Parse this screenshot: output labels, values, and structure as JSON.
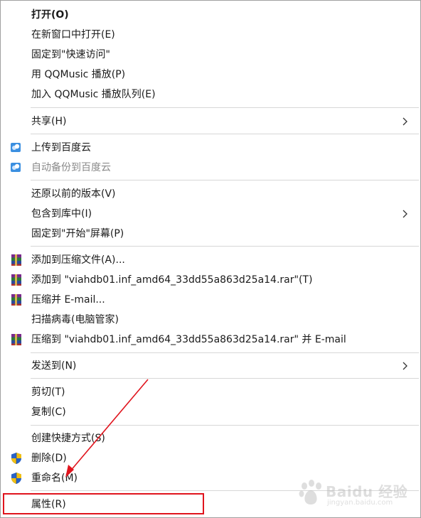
{
  "menu": {
    "groups": [
      {
        "items": [
          {
            "label": "打开(O)",
            "icon": null
          },
          {
            "label": "在新窗口中打开(E)",
            "icon": null
          },
          {
            "label": "固定到\"快速访问\"",
            "icon": null
          },
          {
            "label": "用 QQMusic 播放(P)",
            "icon": null
          },
          {
            "label": "加入 QQMusic 播放队列(E)",
            "icon": null
          }
        ]
      },
      {
        "items": [
          {
            "label": "共享(H)",
            "icon": null,
            "submenu": true
          }
        ]
      },
      {
        "items": [
          {
            "label": "上传到百度云",
            "icon": "baidu-cloud-icon"
          },
          {
            "label": "自动备份到百度云",
            "icon": "baidu-cloud-icon",
            "disabled": true
          }
        ]
      },
      {
        "items": [
          {
            "label": "还原以前的版本(V)",
            "icon": null
          },
          {
            "label": "包含到库中(I)",
            "icon": null,
            "submenu": true
          },
          {
            "label": "固定到\"开始\"屏幕(P)",
            "icon": null
          }
        ]
      },
      {
        "items": [
          {
            "label": "添加到压缩文件(A)...",
            "icon": "winrar-icon"
          },
          {
            "label": "添加到 \"viahdb01.inf_amd64_33dd55a863d25a14.rar\"(T)",
            "icon": "winrar-icon"
          },
          {
            "label": "压缩并 E-mail...",
            "icon": "winrar-icon"
          },
          {
            "label": "扫描病毒(电脑管家)",
            "icon": null
          },
          {
            "label": "压缩到 \"viahdb01.inf_amd64_33dd55a863d25a14.rar\" 并 E-mail",
            "icon": "winrar-icon"
          }
        ]
      },
      {
        "items": [
          {
            "label": "发送到(N)",
            "icon": null,
            "submenu": true
          }
        ]
      },
      {
        "items": [
          {
            "label": "剪切(T)",
            "icon": null
          },
          {
            "label": "复制(C)",
            "icon": null
          }
        ]
      },
      {
        "items": [
          {
            "label": "创建快捷方式(S)",
            "icon": null
          },
          {
            "label": "删除(D)",
            "icon": "uac-shield-icon"
          },
          {
            "label": "重命名(M)",
            "icon": "uac-shield-icon"
          }
        ]
      },
      {
        "items": [
          {
            "label": "属性(R)",
            "icon": null,
            "highlighted": true
          }
        ]
      }
    ]
  },
  "watermark": {
    "text": "Baidu 经验",
    "sub": "jingyan.baidu.com"
  },
  "colors": {
    "annotation": "#e0141d",
    "separator": "#d7d7d7",
    "disabled_text": "#8a8a8a"
  }
}
